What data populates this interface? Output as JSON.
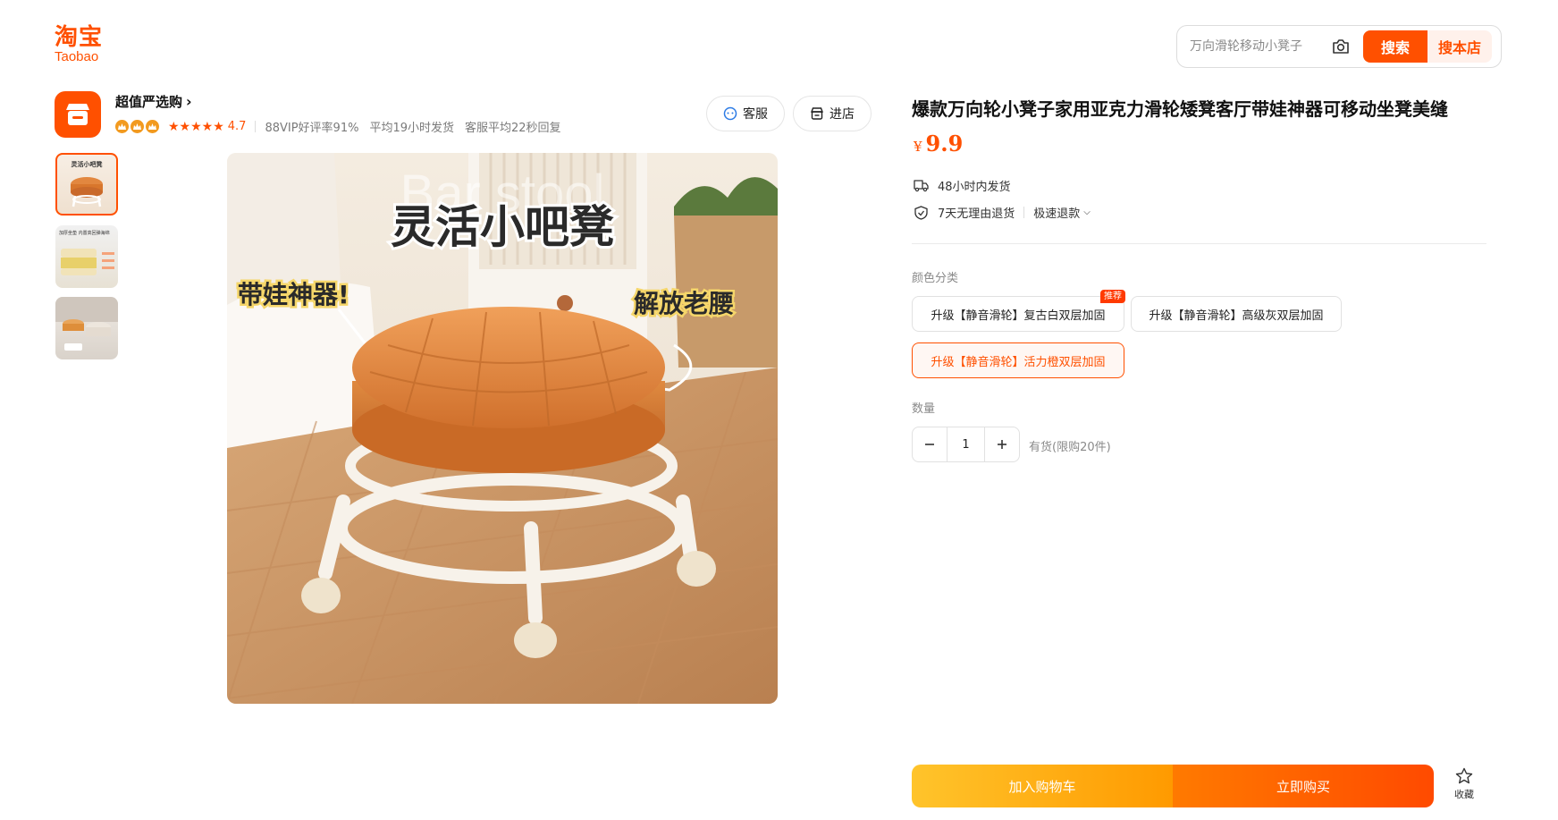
{
  "brand": {
    "name_cn": "淘宝",
    "name_en": "Taobao",
    "color": "#ff5000"
  },
  "search": {
    "placeholder": "万向滑轮移动小凳子",
    "search_label": "搜索",
    "search_store_label": "搜本店",
    "camera_icon": "camera-icon"
  },
  "shop": {
    "name": "超值严选购",
    "rating": "4.7",
    "stars": "★★★★★",
    "vip_rate": "88VIP好评率91%",
    "ship_time": "平均19小时发货",
    "reply_time": "客服平均22秒回复",
    "service_label": "客服",
    "enter_shop_label": "进店"
  },
  "gallery": {
    "thumbs": [
      {
        "caption": "灵活小吧凳"
      },
      {
        "caption": "加厚坐垫 内置高回弹海绵"
      },
      {
        "caption": ""
      }
    ],
    "main": {
      "headline": "灵活小吧凳",
      "bg_text": "Bar stool",
      "left_tag": "带娃神器!",
      "right_tag": "解放老腰"
    }
  },
  "product": {
    "title": "爆款万向轮小凳子家用亚克力滑轮矮凳客厅带娃神器可移动坐凳美缝",
    "currency": "¥",
    "price": "9.9",
    "shipping": "48小时内发货",
    "returns": "7天无理由退货",
    "refund": "极速退款",
    "color_label": "颜色分类",
    "options": [
      {
        "label": "升级【静音滑轮】复古白双层加固",
        "badge": "推荐",
        "selected": false
      },
      {
        "label": "升级【静音滑轮】高级灰双层加固",
        "selected": false
      },
      {
        "label": "升级【静音滑轮】活力橙双层加固",
        "selected": true
      }
    ],
    "qty_label": "数量",
    "qty_value": "1",
    "stock_text": "有货(限购20件)",
    "cart_label": "加入购物车",
    "buy_label": "立即购买",
    "fav_label": "收藏"
  }
}
